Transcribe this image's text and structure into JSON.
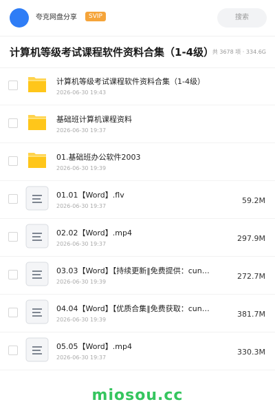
{
  "header": {
    "username": "夸克网盘分享",
    "badge": "SVIP",
    "search_placeholder": "搜索"
  },
  "title_bar": {
    "title": "计算机等级考试课程软件资料合集（1-4级）",
    "meta": "共 3678 项 · 334.6G"
  },
  "files": [
    {
      "type": "folder",
      "name": "计算机等级考试课程软件资料合集（1-4级）",
      "date": "2026-06-30 19:43",
      "size": ""
    },
    {
      "type": "folder",
      "name": "基础班计算机课程资料",
      "date": "2026-06-30 19:37",
      "size": ""
    },
    {
      "type": "folder",
      "name": "01.基础班办公软件2003",
      "date": "2026-06-30 19:39",
      "size": ""
    },
    {
      "type": "file",
      "name": "01.01【Word】.flv",
      "date": "2026-06-30 19:37",
      "size": "59.2M"
    },
    {
      "type": "file",
      "name": "02.02【Word】.mp4",
      "date": "2026-06-30 19:37",
      "size": "297.9M"
    },
    {
      "type": "file",
      "name": "03.03【Word】【持续更新‖免费提供：cun…",
      "date": "2026-06-30 19:39",
      "size": "272.7M"
    },
    {
      "type": "file",
      "name": "04.04【Word】【优质合集‖免费获取：cun…",
      "date": "2026-06-30 19:39",
      "size": "381.7M"
    },
    {
      "type": "file",
      "name": "05.05【Word】.mp4",
      "date": "2026-06-30 19:37",
      "size": "330.3M"
    }
  ],
  "watermark": "miosou.cc",
  "colors": {
    "avatar": "#2f7df6",
    "badge": "#f5a43a",
    "folder": "#ffc61a",
    "watermark": "#35c55e"
  },
  "icons": {
    "folder": "folder-icon",
    "file": "document-icon"
  }
}
